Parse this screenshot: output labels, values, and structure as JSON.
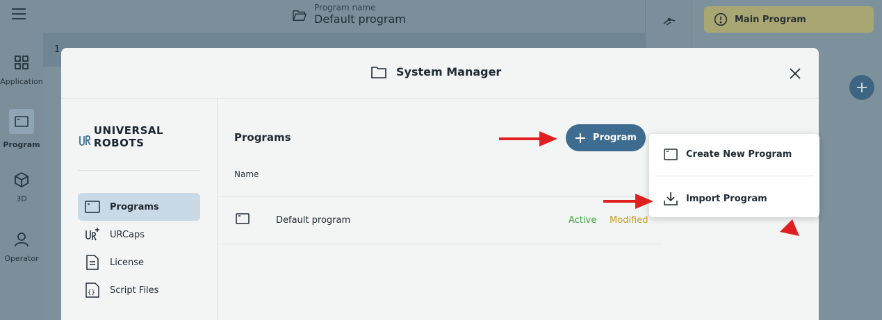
{
  "rail": {
    "items": [
      {
        "label": "Application",
        "icon": "grid-icon"
      },
      {
        "label": "Program",
        "icon": "program-icon"
      },
      {
        "label": "3D",
        "icon": "cube-icon"
      },
      {
        "label": "Operator",
        "icon": "person-icon"
      }
    ]
  },
  "background": {
    "program_name_label": "Program name",
    "program_name_value": "Default program",
    "row_number": "1",
    "main_program_badge": "Main Program"
  },
  "modal": {
    "title": "System Manager",
    "logo_text": "UNIVERSAL ROBOTS",
    "nav": [
      {
        "label": "Programs",
        "active": true
      },
      {
        "label": "URCaps"
      },
      {
        "label": "License"
      },
      {
        "label": "Script Files"
      }
    ],
    "main": {
      "title": "Programs",
      "add_button_label": "Program",
      "column_name": "Name",
      "rows": [
        {
          "name": "Default program",
          "status_active": "Active",
          "status_modified": "Modified"
        }
      ]
    },
    "dropdown": {
      "items": [
        {
          "label": "Create New Program",
          "icon": "program-icon"
        },
        {
          "label": "Import Program",
          "icon": "download-icon"
        }
      ]
    }
  },
  "colors": {
    "accent": "#3e6b90",
    "active": "#3da53d",
    "modified": "#c59a16",
    "annotation": "#e02020"
  }
}
